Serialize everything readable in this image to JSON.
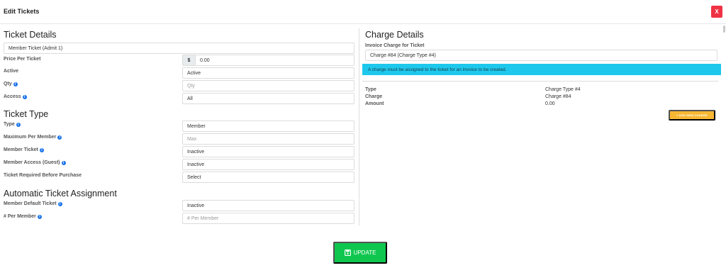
{
  "modal": {
    "title": "Edit Tickets",
    "close_label": "X"
  },
  "ticket_details": {
    "heading": "Ticket Details",
    "ticket_name": "Member Ticket (Admit 1)",
    "price_label": "Price Per Ticket",
    "currency_symbol": "$",
    "price_value": "0.00",
    "active_label": "Active",
    "active_value": "Active",
    "qty_label": "Qty",
    "qty_placeholder": "Qty",
    "access_label": "Access",
    "access_value": "All"
  },
  "ticket_type": {
    "heading": "Ticket Type",
    "type_label": "Type",
    "type_value": "Member",
    "max_per_member_label": "Maximum Per Member",
    "max_per_member_placeholder": "Max",
    "member_ticket_label": "Member Ticket",
    "member_ticket_value": "Inactive",
    "member_access_label": "Member Access (Guest)",
    "member_access_value": "Inactive",
    "ticket_required_label": "Ticket Required Before Purchase",
    "ticket_required_value": "Select"
  },
  "auto_assignment": {
    "heading": "Automatic Ticket Assignment",
    "default_ticket_label": "Member Default Ticket",
    "default_ticket_value": "Inactive",
    "per_member_label": "# Per Member",
    "per_member_placeholder": "# Per Member"
  },
  "charge_details": {
    "heading": "Charge Details",
    "invoice_label": "Invoice Charge for Ticket",
    "invoice_value": "Charge #84 (Charge Type #4)",
    "alert": "A charge must be assigned to the ticket for an invoice to be created.",
    "type_label": "Type",
    "type_value": "Charge Type #4",
    "charge_label": "Charge",
    "charge_value": "Charge #84",
    "amount_label": "Amount",
    "amount_value": "0.00",
    "add_button": "+ ADD NEW CHARGE"
  },
  "footer": {
    "update_label": "UPDATE"
  },
  "colors": {
    "danger": "#ef3344",
    "info_banner": "#1ec8ec",
    "warning": "#f7b733",
    "success": "#0fc74f",
    "info_icon": "#1a73e8"
  }
}
